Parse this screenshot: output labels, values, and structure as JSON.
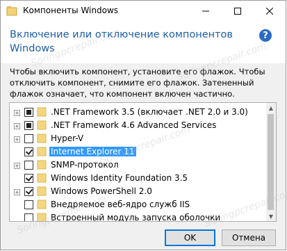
{
  "window": {
    "title": "Компоненты Windows",
    "heading": "Включение или отключение компонентов Windows",
    "instructions": "Чтобы включить компонент, установите его флажок. Чтобы отключить компонент, снимите его флажок. Затененный флажок означает, что компонент включен частично."
  },
  "features": [
    {
      "label": ".NET Framework 3.5 (включает .NET 2.0 и 3.0)",
      "expandable": true,
      "state": "partial",
      "selected": false
    },
    {
      "label": ".NET Framework 4.6 Advanced Services",
      "expandable": true,
      "state": "partial",
      "selected": false
    },
    {
      "label": "Hyper-V",
      "expandable": true,
      "state": "unchecked",
      "selected": false
    },
    {
      "label": "Internet Explorer 11",
      "expandable": false,
      "state": "checked",
      "selected": true
    },
    {
      "label": "SNMP-протокол",
      "expandable": true,
      "state": "unchecked",
      "selected": false
    },
    {
      "label": "Windows Identity Foundation 3.5",
      "expandable": false,
      "state": "checked",
      "selected": false
    },
    {
      "label": "Windows PowerShell 2.0",
      "expandable": true,
      "state": "checked",
      "selected": false
    },
    {
      "label": "Внедряемое веб-ядро служб IIS",
      "expandable": false,
      "state": "unchecked",
      "selected": false
    },
    {
      "label": "Встроенный модуль запуска оболочки",
      "expandable": false,
      "state": "unchecked",
      "selected": false
    }
  ],
  "buttons": {
    "ok": "OK",
    "cancel": "Отмена"
  },
  "watermark": "Soringpcrepair.com",
  "colors": {
    "heading": "#1c5ea8",
    "selection": "#3399ff",
    "folder": "#f5d680",
    "help": "#2a6ac4"
  }
}
